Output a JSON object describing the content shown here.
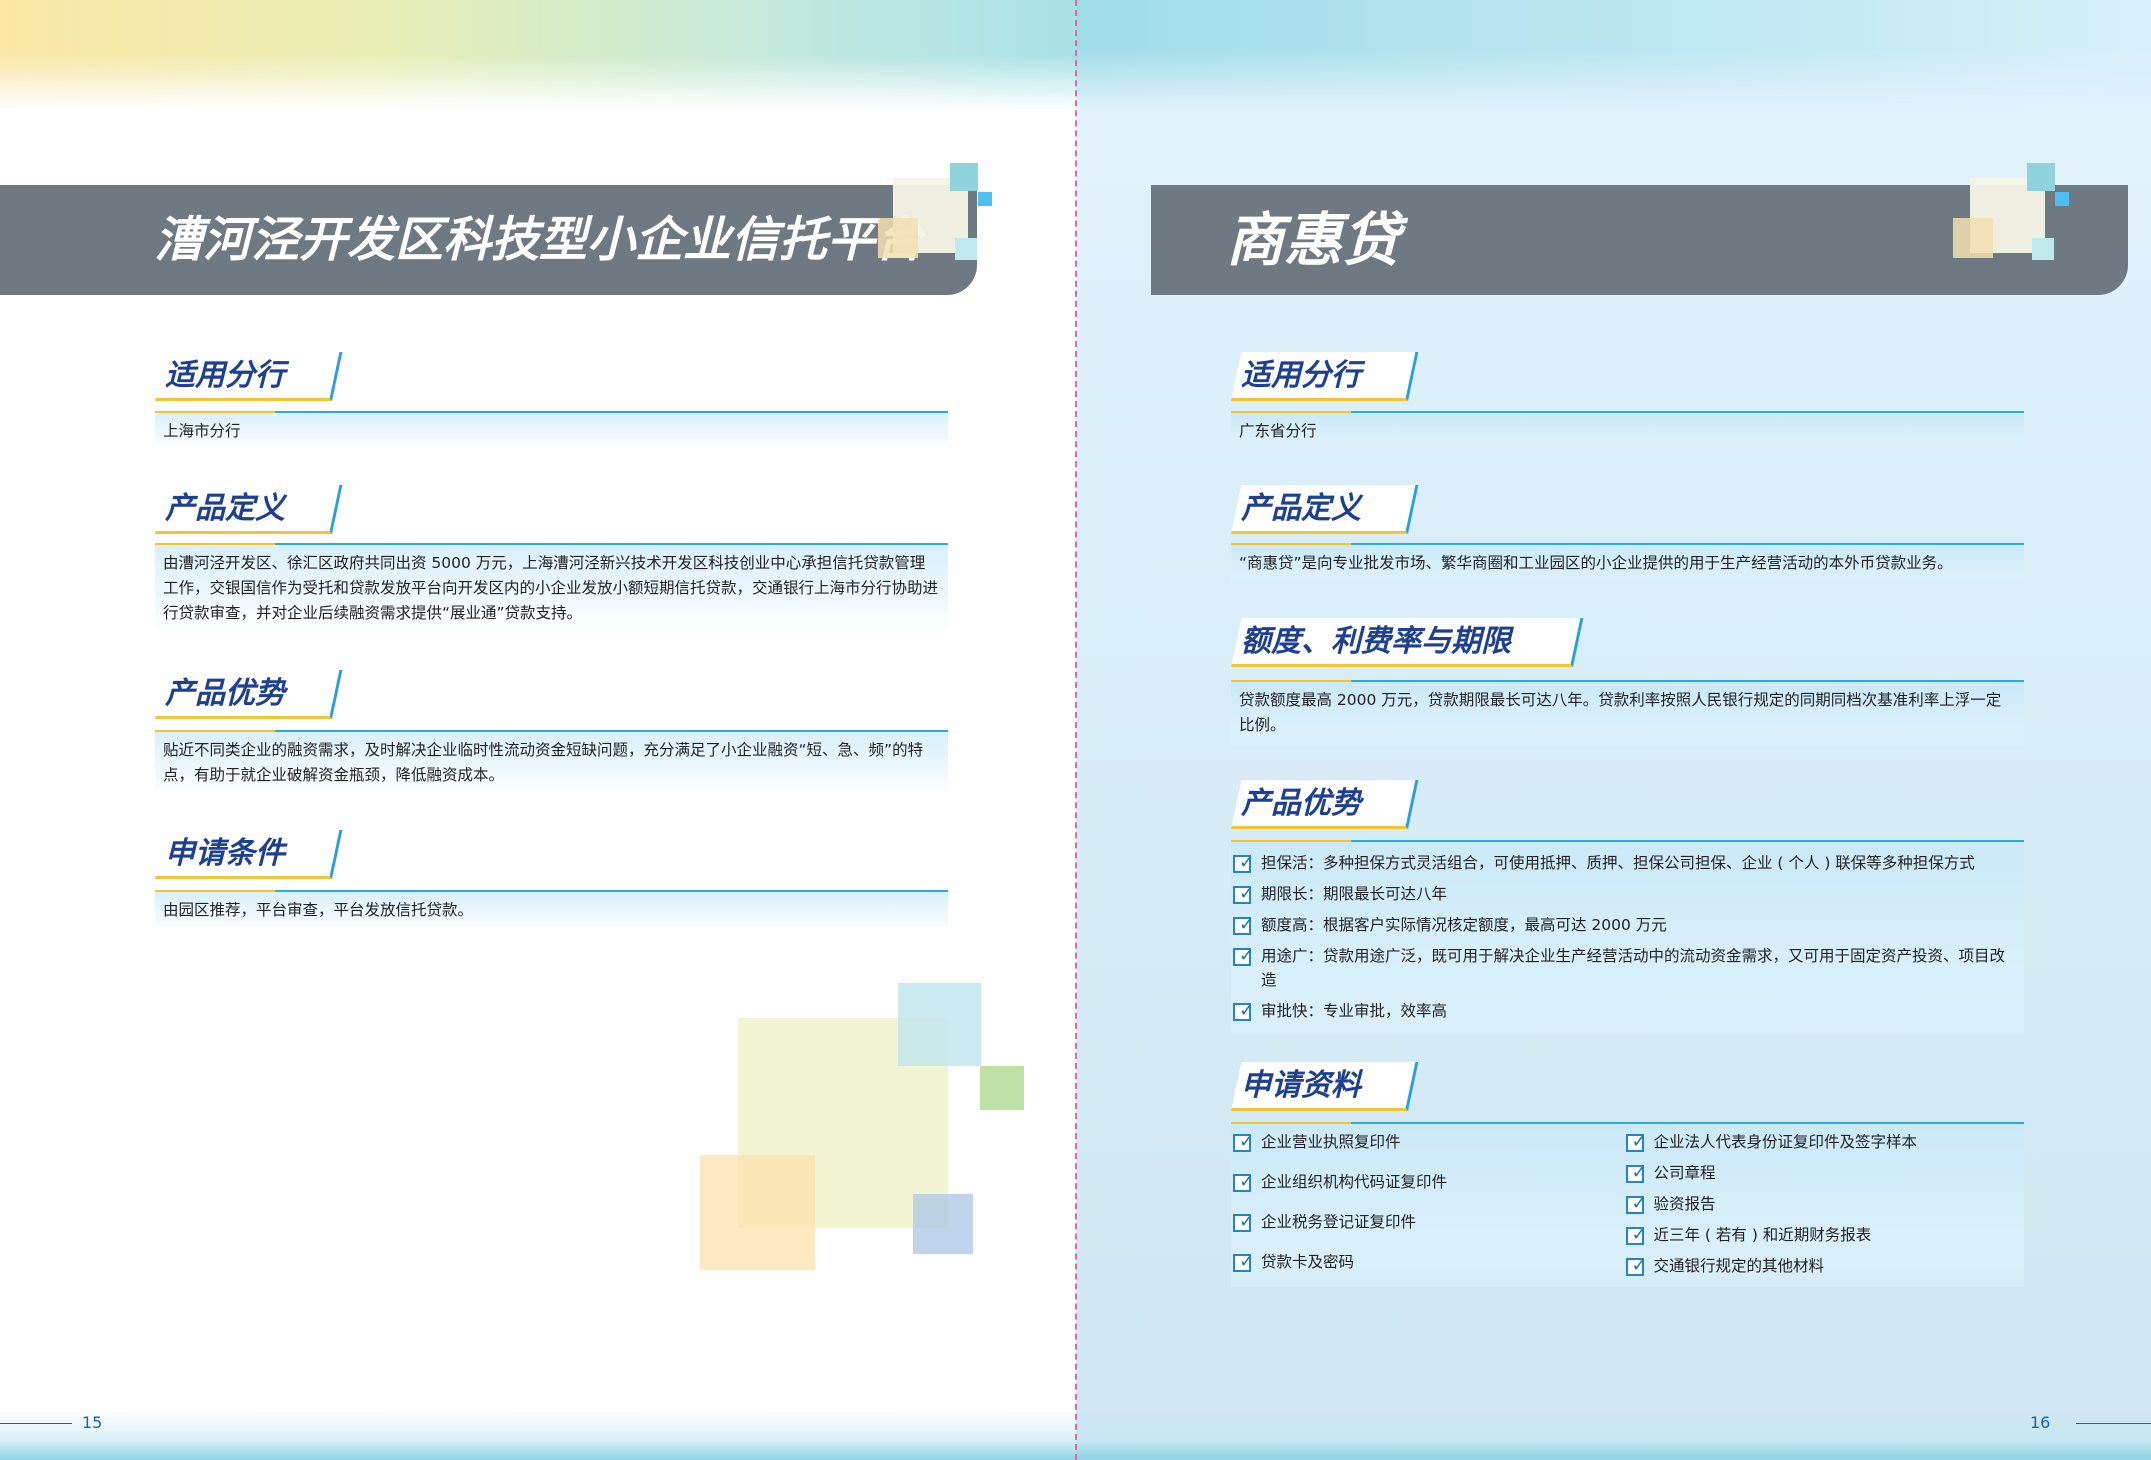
{
  "left": {
    "title": "漕河泾开发区科技型小企业信托平台",
    "page_number": "15",
    "sections": [
      {
        "heading": "适用分行",
        "body": "上海市分行"
      },
      {
        "heading": "产品定义",
        "body": "由漕河泾开发区、徐汇区政府共同出资 5000 万元，上海漕河泾新兴技术开发区科技创业中心承担信托贷款管理工作，交银国信作为受托和贷款发放平台向开发区内的小企业发放小额短期信托贷款，交通银行上海市分行协助进行贷款审查，并对企业后续融资需求提供“展业通”贷款支持。"
      },
      {
        "heading": "产品优势",
        "body": "贴近不同类企业的融资需求，及时解决企业临时性流动资金短缺问题，充分满足了小企业融资“短、急、频”的特点，有助于就企业破解资金瓶颈，降低融资成本。"
      },
      {
        "heading": "申请条件",
        "body": "由园区推荐，平台审查，平台发放信托贷款。"
      }
    ]
  },
  "right": {
    "title": "商惠贷",
    "page_number": "16",
    "sections": [
      {
        "heading": "适用分行",
        "body": "广东省分行"
      },
      {
        "heading": "产品定义",
        "body": "“商惠贷”是向专业批发市场、繁华商圈和工业园区的小企业提供的用于生产经营活动的本外币贷款业务。"
      },
      {
        "heading": "额度、利费率与期限",
        "body": "贷款额度最高 2000 万元，贷款期限最长可达八年。贷款利率按照人民银行规定的同期同档次基准利率上浮一定比例。"
      },
      {
        "heading": "产品优势",
        "items": [
          "担保活：多种担保方式灵活组合，可使用抵押、质押、担保公司担保、企业 ( 个人 ) 联保等多种担保方式",
          "期限长：期限最长可达八年",
          "额度高：根据客户实际情况核定额度，最高可达 2000 万元",
          "用途广：贷款用途广泛，既可用于解决企业生产经营活动中的流动资金需求，又可用于固定资产投资、项目改造",
          "审批快：专业审批，效率高"
        ]
      },
      {
        "heading": "申请资料",
        "col1": [
          "企业营业执照复印件",
          "企业组织机构代码证复印件",
          "企业税务登记证复印件",
          "贷款卡及密码"
        ],
        "col2": [
          "企业法人代表身份证复印件及签字样本",
          "公司章程",
          "验资报告",
          "近三年 ( 若有 ) 和近期财务报表",
          "交通银行规定的其他材料"
        ]
      }
    ]
  },
  "colors": {
    "title_bar": "#6f7981",
    "heading_text": "#1f3f8f",
    "accent_blue": "#2eaadf",
    "accent_yellow": "#f3c534",
    "spine": "#e26aa4"
  },
  "icons": {
    "checkbox": "checked-box-icon"
  }
}
